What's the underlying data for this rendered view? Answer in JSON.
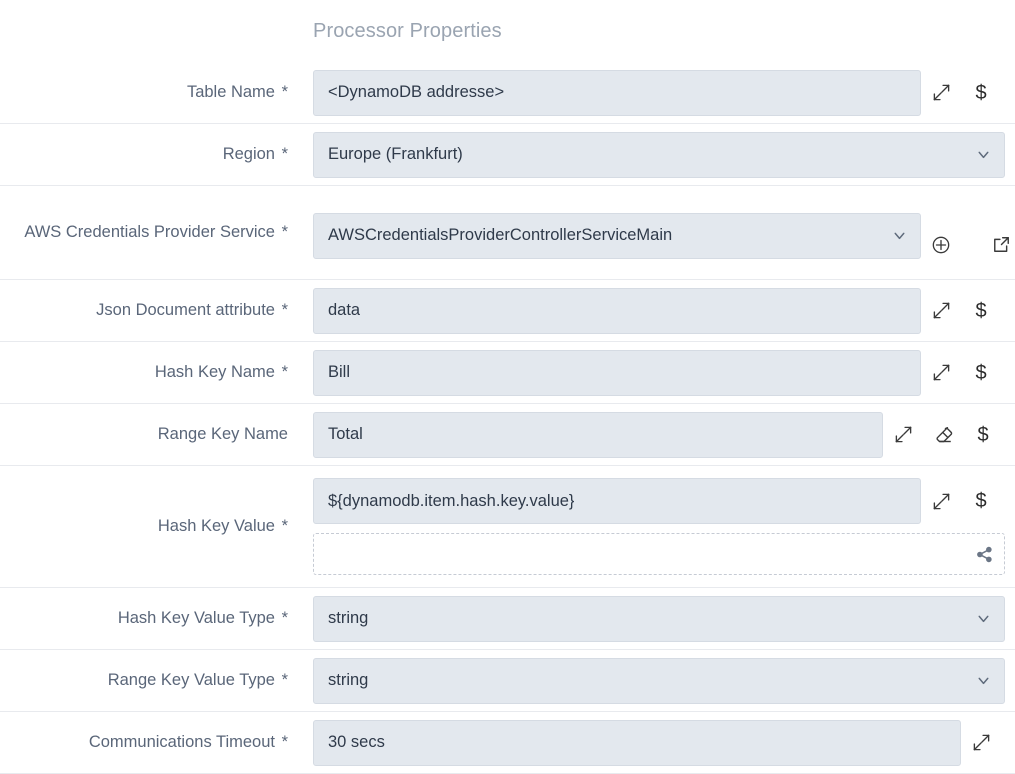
{
  "header": {
    "title": "Processor Properties"
  },
  "colors": {
    "field_bg": "#e3e8ee",
    "field_text": "#2f3a4a",
    "label_text": "#5a6679",
    "title_text": "#9aa4b1",
    "divider": "#e8eaee"
  },
  "icons": {
    "expand": "expand-arrows-icon",
    "dollar": "dollar-sign-icon",
    "plus_circle": "plus-circle-icon",
    "external_link": "external-link-icon",
    "eraser": "eraser-icon",
    "share": "share-icon",
    "chevron_down": "chevron-down-icon",
    "dollar_glyph": "$"
  },
  "properties": [
    {
      "label": "Table Name",
      "required": true,
      "type": "text",
      "value": "<DynamoDB addresse>"
    },
    {
      "label": "Region",
      "required": true,
      "type": "dropdown",
      "value": "Europe (Frankfurt)"
    },
    {
      "label": "AWS Credentials Provider Service",
      "required": true,
      "type": "dropdown",
      "value": "AWSCredentialsProviderControllerServiceMain"
    },
    {
      "label": "Json Document attribute",
      "required": true,
      "type": "text",
      "value": "data"
    },
    {
      "label": "Hash Key Name",
      "required": true,
      "type": "text",
      "value": "Bill"
    },
    {
      "label": "Range Key Name",
      "required": false,
      "type": "text",
      "value": "Total"
    },
    {
      "label": "Hash Key Value",
      "required": true,
      "type": "text-with-extra",
      "value": "${dynamodb.item.hash.key.value}",
      "extra_value": ""
    },
    {
      "label": "Hash Key Value Type",
      "required": true,
      "type": "dropdown",
      "value": "string"
    },
    {
      "label": "Range Key Value Type",
      "required": true,
      "type": "dropdown",
      "value": "string"
    },
    {
      "label": "Communications Timeout",
      "required": true,
      "type": "text",
      "value": "30 secs"
    }
  ]
}
